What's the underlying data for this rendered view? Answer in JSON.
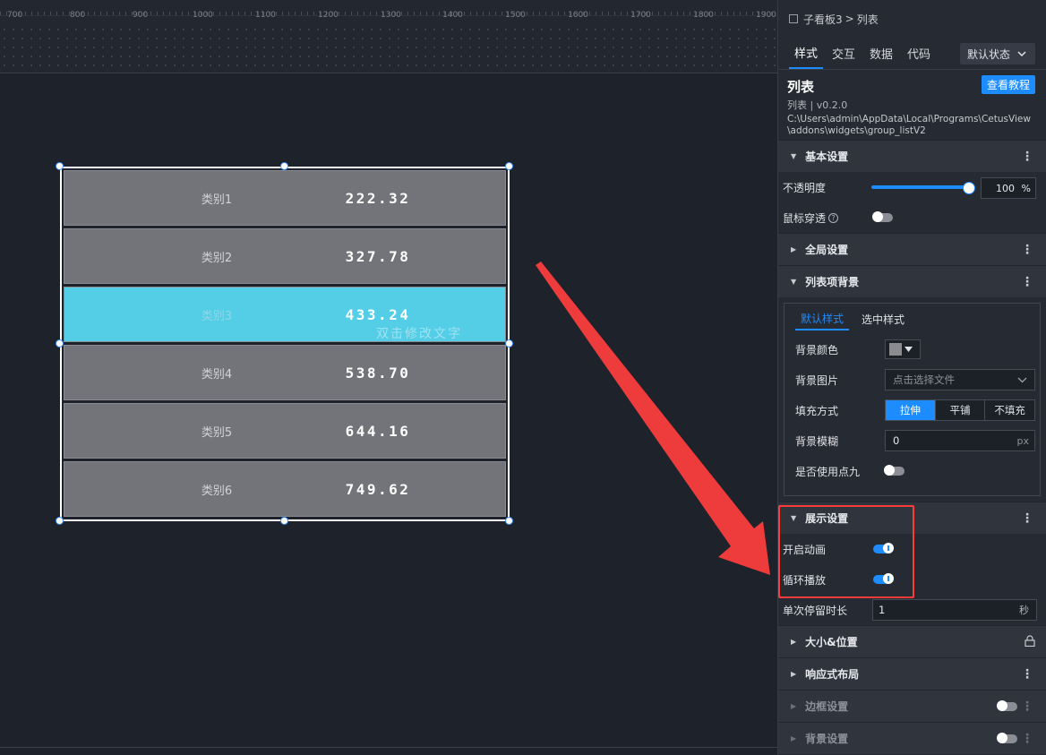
{
  "ruler": {
    "labels": [
      "700",
      "800",
      "900",
      "1000",
      "1100",
      "1200",
      "1300",
      "1400",
      "1500",
      "1600",
      "1700",
      "1800",
      "1900"
    ]
  },
  "widget": {
    "rows": [
      {
        "category": "类别1",
        "value": "222.32"
      },
      {
        "category": "类别2",
        "value": "327.78"
      },
      {
        "category": "类别3",
        "value": "433.24"
      },
      {
        "category": "类别4",
        "value": "538.70"
      },
      {
        "category": "类别5",
        "value": "644.16"
      },
      {
        "category": "类别6",
        "value": "749.62"
      }
    ],
    "active_row": 2,
    "hint": "双击修改文字",
    "row_color": "#737479",
    "active_color": "#54cde7"
  },
  "panel": {
    "breadcrumb": {
      "parent": "子看板3",
      "separator": ">",
      "current": "列表"
    },
    "tabs": [
      "样式",
      "交互",
      "数据",
      "代码"
    ],
    "state_select": "默认状态",
    "info": {
      "title": "列表",
      "version": "列表 | v0.2.0",
      "path": "C:\\Users\\admin\\AppData\\Local\\Programs\\CetusView\\addons\\widgets\\group_listV2",
      "tutorial": "查看教程"
    },
    "sections": {
      "basic": "基本设置",
      "global": "全局设置",
      "item_bg": "列表项背景",
      "display": "展示设置",
      "size_pos": "大小&位置",
      "responsive": "响应式布局",
      "border": "边框设置",
      "background": "背景设置"
    },
    "basic": {
      "opacity_label": "不透明度",
      "opacity_value": "100",
      "opacity_unit": "%",
      "mouse_label": "鼠标穿透",
      "help_icon": "?"
    },
    "item_bg": {
      "tabs": [
        "默认样式",
        "选中样式"
      ],
      "color_label": "背景颜色",
      "image_label": "背景图片",
      "image_placeholder": "点击选择文件",
      "fill_label": "填充方式",
      "fill_options": [
        "拉伸",
        "平铺",
        "不填充"
      ],
      "blur_label": "背景模糊",
      "blur_value": "0",
      "blur_unit": "px",
      "nine_label": "是否使用点九"
    },
    "display": {
      "animate_label": "开启动画",
      "loop_label": "循环播放",
      "dwell_label": "单次停留时长",
      "dwell_value": "1",
      "dwell_unit": "秒"
    },
    "accent": "#1d8cff",
    "highlight": "#ff3b3b"
  }
}
